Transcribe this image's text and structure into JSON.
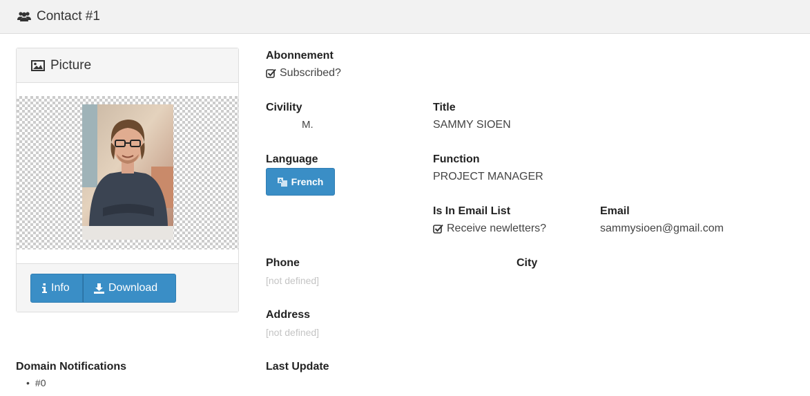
{
  "header": {
    "title": "Contact #1",
    "icon": "users-icon"
  },
  "picture_panel": {
    "title": "Picture",
    "icon": "image-icon",
    "info_label": "Info",
    "download_label": "Download"
  },
  "fields": {
    "abonnement": {
      "label": "Abonnement",
      "value": "Subscribed?"
    },
    "civility": {
      "label": "Civility",
      "value": "M."
    },
    "title": {
      "label": "Title",
      "value": "SAMMY SIOEN"
    },
    "language": {
      "label": "Language",
      "value": "French"
    },
    "function": {
      "label": "Function",
      "value": "PROJECT MANAGER"
    },
    "email_list": {
      "label": "Is In Email List",
      "value": "Receive newletters?"
    },
    "email": {
      "label": "Email",
      "value": "sammysioen@gmail.com"
    },
    "phone": {
      "label": "Phone",
      "value": "[not defined]"
    },
    "city": {
      "label": "City",
      "value": ""
    },
    "address": {
      "label": "Address",
      "value": "[not defined]"
    },
    "last_update": {
      "label": "Last Update",
      "value": ""
    }
  },
  "domain_notifications": {
    "label": "Domain Notifications",
    "items": [
      "#0"
    ]
  },
  "colors": {
    "accent": "#3a8ec6",
    "header_bg": "#f2f2f2",
    "muted": "#c4c4c4"
  }
}
